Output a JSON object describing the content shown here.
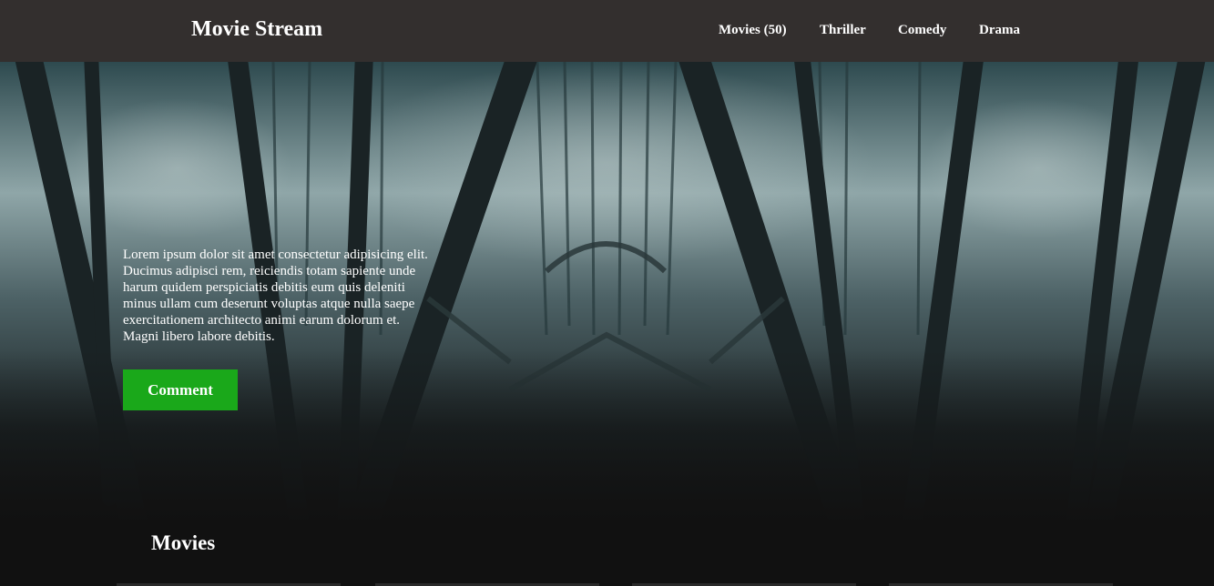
{
  "navbar": {
    "brand": "Movie Stream",
    "links": [
      "Movies (50)",
      "Thriller",
      "Comedy",
      "Drama"
    ]
  },
  "hero": {
    "description": "Lorem ipsum dolor sit amet consectetur adipisicing elit. Ducimus adipisci rem, reiciendis totam sapiente unde harum quidem perspiciatis debitis eum quis deleniti minus ullam cum deserunt voluptas atque nulla saepe exercitationem architecto animi earum dolorum et. Magni libero labore debitis.",
    "button_label": "Comment"
  },
  "movies_section": {
    "title": "Movies"
  },
  "colors": {
    "navbar_bg": "#332f2e",
    "accent_green": "#1aa81a",
    "page_bg": "#111111"
  }
}
